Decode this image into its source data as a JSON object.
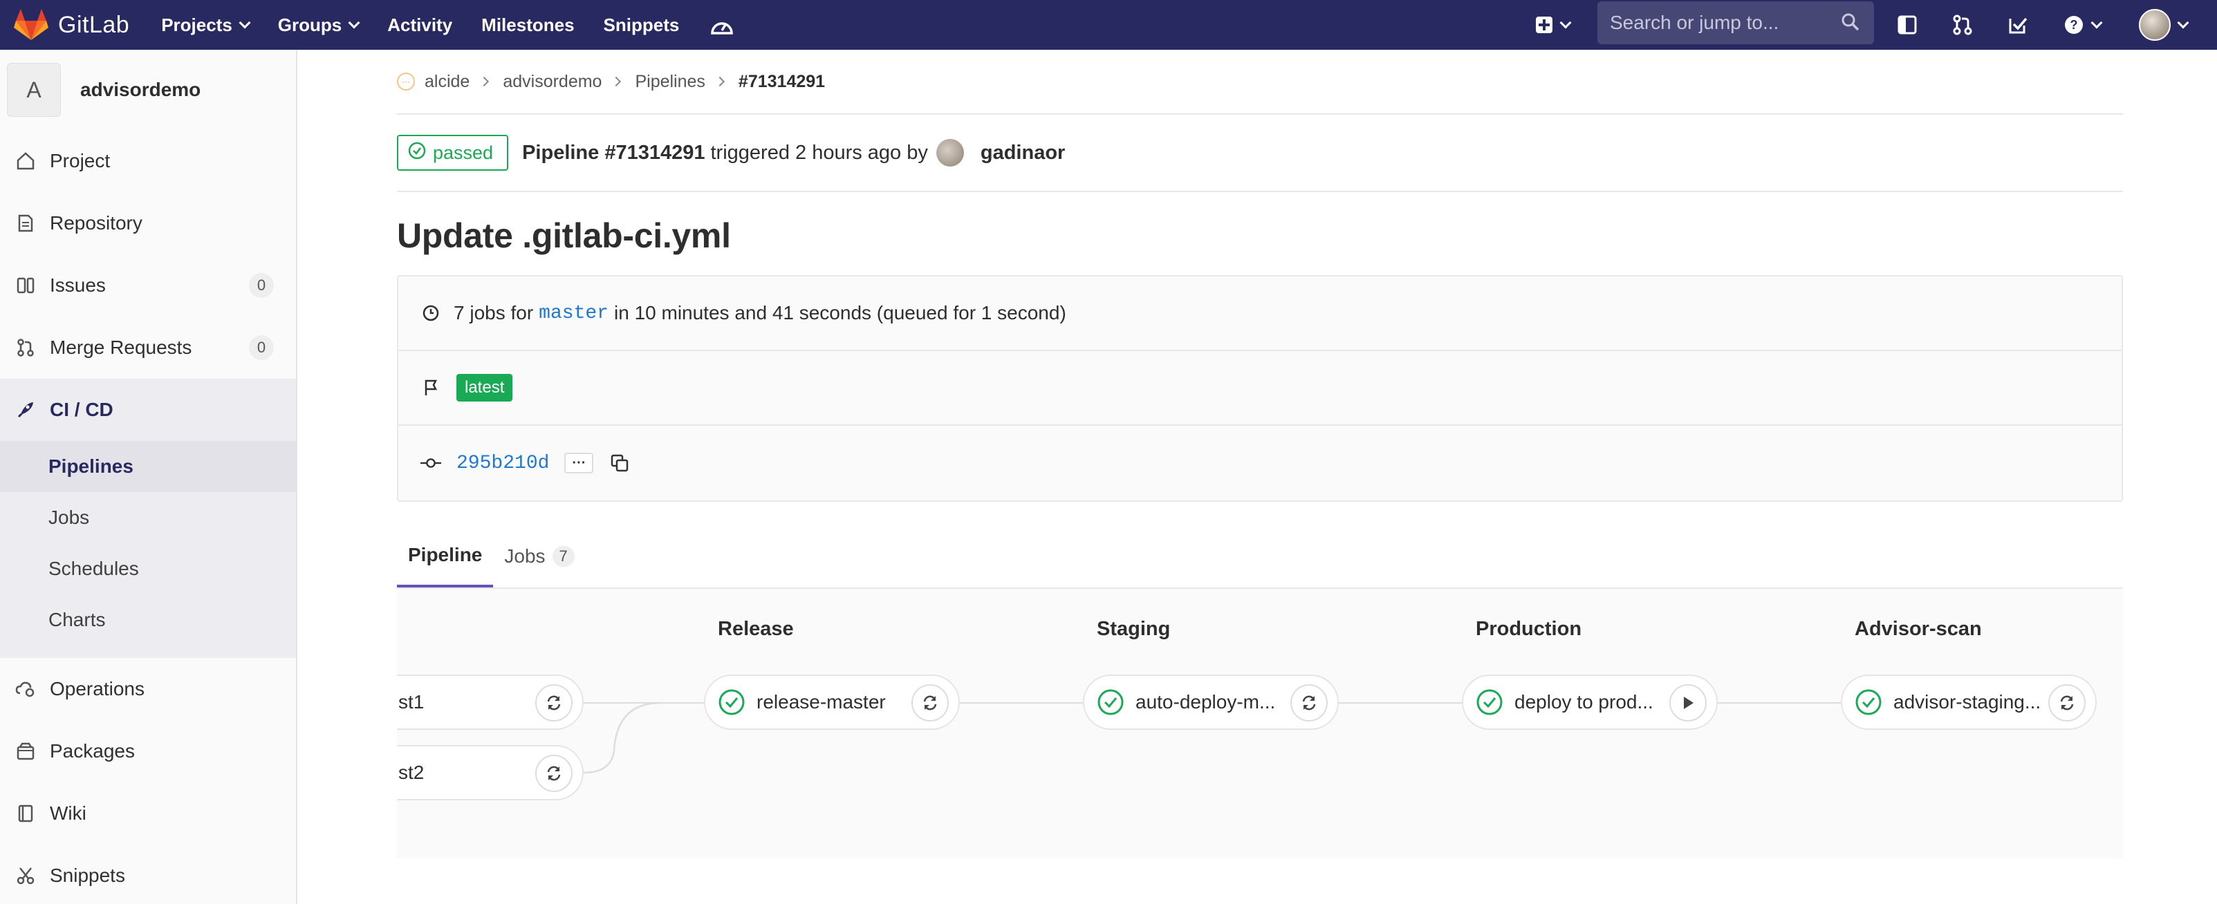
{
  "nav": {
    "brand": "GitLab",
    "links": [
      "Projects",
      "Groups",
      "Activity",
      "Milestones",
      "Snippets"
    ],
    "search_placeholder": "Search or jump to..."
  },
  "sidebar": {
    "project_initial": "A",
    "project_name": "advisordemo",
    "items": [
      {
        "label": "Project",
        "icon": "home-icon"
      },
      {
        "label": "Repository",
        "icon": "doc-icon"
      },
      {
        "label": "Issues",
        "icon": "issues-icon",
        "count": "0"
      },
      {
        "label": "Merge Requests",
        "icon": "merge-request-icon",
        "count": "0"
      },
      {
        "label": "CI / CD",
        "icon": "rocket-icon"
      },
      {
        "label": "Operations",
        "icon": "cloud-gear-icon"
      },
      {
        "label": "Packages",
        "icon": "package-icon"
      },
      {
        "label": "Wiki",
        "icon": "book-icon"
      },
      {
        "label": "Snippets",
        "icon": "scissors-icon"
      }
    ],
    "cicd_sub": [
      "Pipelines",
      "Jobs",
      "Schedules",
      "Charts"
    ]
  },
  "breadcrumbs": [
    "alcide",
    "advisordemo",
    "Pipelines",
    "#71314291"
  ],
  "pipeline_header": {
    "status": "passed",
    "pipeline_label": "Pipeline #71314291",
    "triggered_text": "triggered 2 hours ago by",
    "user": "gadinaor"
  },
  "commit_title": "Update .gitlab-ci.yml",
  "info": {
    "jobs_prefix": "7 jobs for",
    "branch": "master",
    "duration_text": "in 10 minutes and 41 seconds (queued for 1 second)",
    "tag": "latest",
    "sha": "295b210d",
    "ellipsis": "···"
  },
  "tabs": [
    {
      "label": "Pipeline"
    },
    {
      "label": "Jobs",
      "count": "7"
    }
  ],
  "graph": {
    "stages": [
      "Release",
      "Staging",
      "Production",
      "Advisor-scan"
    ],
    "jobs": {
      "test1": "st1",
      "test2": "st2",
      "release": "release-master",
      "staging": "auto-deploy-m...",
      "production": "deploy to prod...",
      "advisor": "advisor-staging..."
    }
  },
  "colors": {
    "navbar": "#292961",
    "success": "#1aaa55",
    "link": "#1f78d1",
    "active_tab": "#6b4fbb"
  }
}
